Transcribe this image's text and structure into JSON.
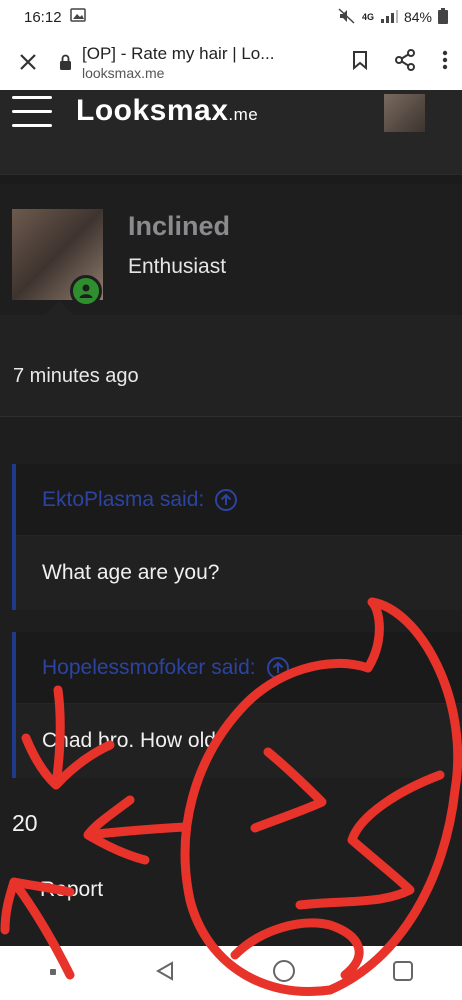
{
  "status": {
    "time": "16:12",
    "battery": "84%",
    "network": "4G"
  },
  "browser": {
    "tab_title": "[OP] - Rate my hair | Lo...",
    "domain": "looksmax.me"
  },
  "site": {
    "logo_main": "Looksmax",
    "logo_suffix": ".me"
  },
  "user": {
    "name": "Inclined",
    "title": "Enthusiast"
  },
  "post": {
    "time_ago": "7 minutes ago",
    "quotes": [
      {
        "author": "EktoPlasma said:",
        "text": "What age are you?"
      },
      {
        "author": "Hopelessmofoker said:",
        "text": "Chad bro. How old"
      }
    ],
    "reply": "20",
    "report": "Report"
  },
  "colors": {
    "annotation": "#e8332b",
    "quote_accent": "#203a8a",
    "online": "#2f8f2f"
  }
}
